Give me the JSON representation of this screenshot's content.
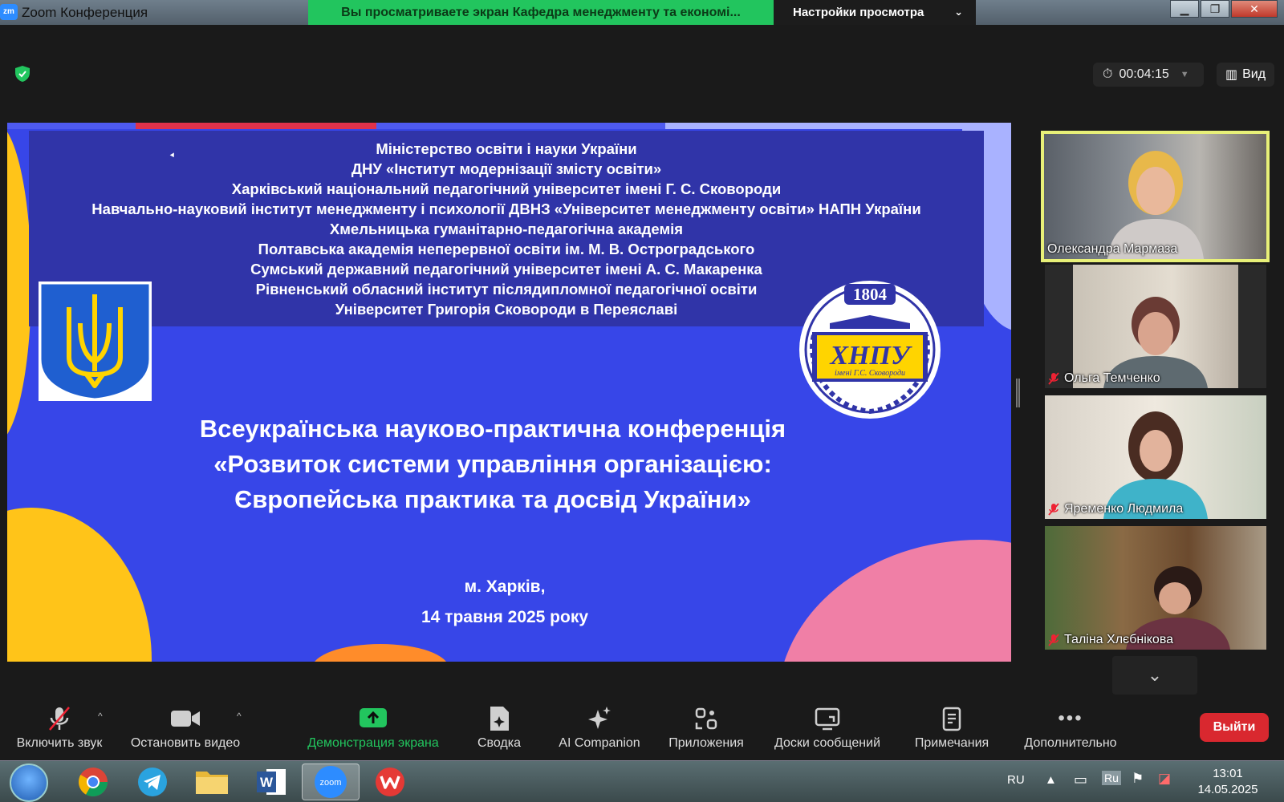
{
  "window": {
    "app_icon_text": "zm",
    "title": "Zoom Конференция",
    "min": "▁",
    "max": "❐",
    "close": "✕"
  },
  "share_banner": "Вы просматриваете экран Кафедра менеджменту та економі...",
  "view_settings": "Настройки просмотра",
  "meeting_timer": "00:04:15",
  "view_button": "Вид",
  "slide": {
    "institutions": [
      "Міністерство освіти і науки України",
      "ДНУ «Інститут модернізації змісту освіти»",
      "Харківський національний педагогічний університет імені Г. С. Сковороди",
      "Навчально-науковий інститут менеджменту і психології ДВНЗ «Університет менеджменту освіти» НАПН України",
      "Хмельницька гуманітарно-педагогічна академія",
      "Полтавська академія неперервної освіти ім. М. В. Остроградського",
      "Сумський державний педагогічний університет імені А. С. Макаренка",
      "Рівненський обласний інститут післядипломної педагогічної освіти",
      "Університет Григорія Сковороди в Переяславі"
    ],
    "emblem": {
      "year": "1804",
      "abbr": "ХНПУ",
      "sub": "імені Г.С. Сковороди"
    },
    "conference_title": [
      "Всеукраїнська науково-практична конференція",
      "«Розвиток системи управління організацією:",
      "Європейська практика та досвід України»"
    ],
    "city": "м. Харків,",
    "date": "14 травня 2025 року"
  },
  "participants": [
    {
      "name": "Олександра Мармаза",
      "muted": false,
      "active": true
    },
    {
      "name": "Ольга Темченко",
      "muted": true,
      "active": false
    },
    {
      "name": "Яременко Людмила",
      "muted": true,
      "active": false
    },
    {
      "name": "Таліна Хлєбнікова",
      "muted": true,
      "active": false
    }
  ],
  "toolbar": {
    "audio": "Включить звук",
    "video": "Остановить видео",
    "share": "Демонстрация экрана",
    "summary": "Сводка",
    "ai": "AI Companion",
    "apps": "Приложения",
    "whiteboards": "Доски сообщений",
    "notes": "Примечания",
    "more": "Дополнительно",
    "leave": "Выйти"
  },
  "taskbar": {
    "lang_left": "RU",
    "lang_tray": "Ru",
    "time": "13:01",
    "date": "14.05.2025",
    "zoom_label": "zoom"
  }
}
